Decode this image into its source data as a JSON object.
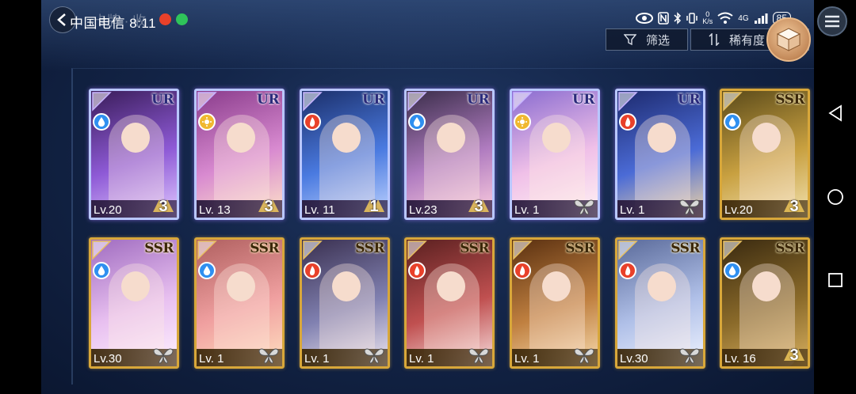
{
  "status_bar": {
    "carrier_time": "中国电信 8:11",
    "ghost_title": "卡牌 · 收",
    "data_speed": "0\nK/s",
    "network": "4G",
    "battery": "85"
  },
  "toolbar": {
    "filter_label": "筛选",
    "sort_label": "稀有度"
  },
  "colors": {
    "water": "#2f8ff0",
    "light": "#f0b830",
    "fire": "#e8412a",
    "ur_border": "#b9c7ff",
    "ssr_border": "#d8a73a"
  },
  "cards": [
    {
      "rarity": "UR",
      "element": "water",
      "level": "Lv.20",
      "badge": "3",
      "art": [
        "#3a1d5a",
        "#8e5ad6",
        "#e0c8ff"
      ]
    },
    {
      "rarity": "UR",
      "element": "light",
      "level": "Lv. 13",
      "badge": "3",
      "art": [
        "#8a3c8c",
        "#d88ad0",
        "#ffe6c8"
      ]
    },
    {
      "rarity": "UR",
      "element": "fire",
      "level": "Lv. 11",
      "badge": "1",
      "art": [
        "#1b2f6a",
        "#4a7ae0",
        "#c0d4ff"
      ]
    },
    {
      "rarity": "UR",
      "element": "water",
      "level": "Lv.23",
      "badge": "3",
      "art": [
        "#3a2d4a",
        "#b07cc0",
        "#ffd0e0"
      ]
    },
    {
      "rarity": "UR",
      "element": "light",
      "level": "Lv. 1",
      "badge": "",
      "art": [
        "#8a6cd0",
        "#f0c0e8",
        "#fff4f4"
      ]
    },
    {
      "rarity": "UR",
      "element": "fire",
      "level": "Lv. 1",
      "badge": "",
      "art": [
        "#1d2a6e",
        "#4b6bd6",
        "#f2d6a6"
      ]
    },
    {
      "rarity": "SSR",
      "element": "water",
      "level": "Lv.20",
      "badge": "3",
      "art": [
        "#5a4a1a",
        "#c8a040",
        "#f2e2b0"
      ]
    },
    {
      "rarity": "SSR",
      "element": "water",
      "level": "Lv.30",
      "badge": "",
      "art": [
        "#a06cc0",
        "#e8c0f0",
        "#fff2ff"
      ]
    },
    {
      "rarity": "SSR",
      "element": "water",
      "level": "Lv. 1",
      "badge": "",
      "art": [
        "#b06060",
        "#f0a0a0",
        "#ffe0c0"
      ]
    },
    {
      "rarity": "SSR",
      "element": "fire",
      "level": "Lv. 1",
      "badge": "",
      "art": [
        "#3a3050",
        "#8080b0",
        "#f0e8f0"
      ]
    },
    {
      "rarity": "SSR",
      "element": "fire",
      "level": "Lv. 1",
      "badge": "",
      "art": [
        "#5a2020",
        "#c05050",
        "#f8e0e0"
      ]
    },
    {
      "rarity": "SSR",
      "element": "fire",
      "level": "Lv. 1",
      "badge": "",
      "art": [
        "#5a3010",
        "#c08040",
        "#f8dcb0"
      ]
    },
    {
      "rarity": "SSR",
      "element": "fire",
      "level": "Lv.30",
      "badge": "",
      "art": [
        "#5a6a9a",
        "#b0c0e8",
        "#f0f4ff"
      ]
    },
    {
      "rarity": "SSR",
      "element": "water",
      "level": "Lv. 16",
      "badge": "3",
      "art": [
        "#3a2a10",
        "#8a6a2a",
        "#d8b060"
      ]
    }
  ]
}
